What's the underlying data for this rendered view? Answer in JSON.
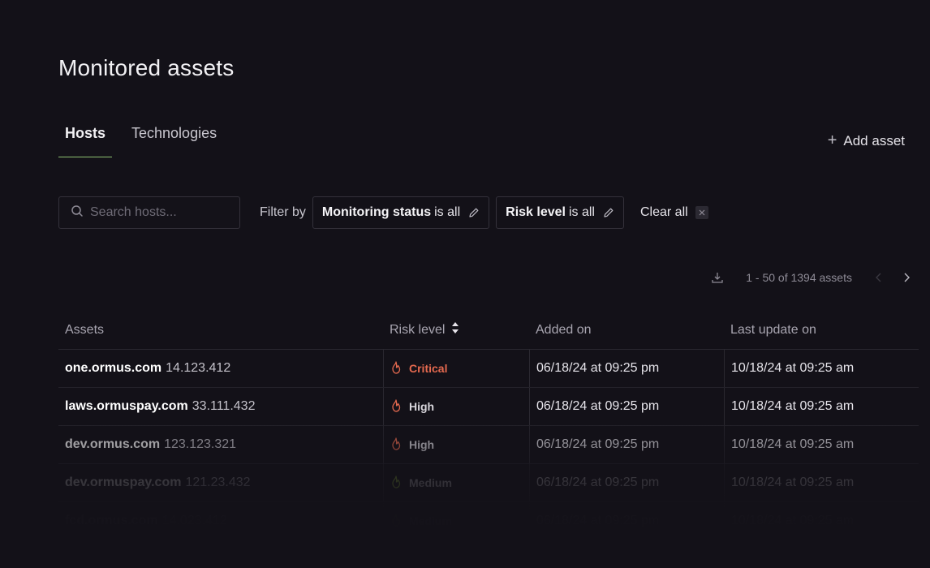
{
  "page": {
    "title": "Monitored assets"
  },
  "tabs": [
    {
      "label": "Hosts",
      "active": true
    },
    {
      "label": "Technologies",
      "active": false
    }
  ],
  "actions": {
    "add_asset": "Add asset"
  },
  "filters": {
    "search_placeholder": "Search hosts...",
    "filter_by": "Filter by",
    "chips": [
      {
        "field": "Monitoring status",
        "value": "is all"
      },
      {
        "field": "Risk level",
        "value": "is all"
      }
    ],
    "clear_all": "Clear all"
  },
  "pagination": {
    "range": "1 - 50 of 1394 assets"
  },
  "table": {
    "columns": [
      "Assets",
      "Risk level",
      "Added on",
      "Last update on"
    ],
    "rows": [
      {
        "host": "one.ormus.com",
        "ip": "14.123.412",
        "risk": "Critical",
        "risk_color": "#e4694f",
        "added": "06/18/24 at 09:25 pm",
        "updated": "10/18/24 at 09:25 am"
      },
      {
        "host": "laws.ormuspay.com",
        "ip": "33.111.432",
        "risk": "High",
        "risk_color": "#e4694f",
        "added": "06/18/24 at 09:25 pm",
        "updated": "10/18/24 at 09:25 am"
      },
      {
        "host": "dev.ormus.com",
        "ip": "123.123.321",
        "risk": "High",
        "risk_color": "#e4694f",
        "added": "06/18/24 at 09:25 pm",
        "updated": "10/18/24 at 09:25 am"
      },
      {
        "host": "dev.ormuspay.com",
        "ip": "121.23.432",
        "risk": "Medium",
        "risk_color": "#a7d63f",
        "added": "06/18/24 at 09:25 pm",
        "updated": "10/18/24 at 09:25 am"
      },
      {
        "host": "fcd.ormus.com",
        "ip": "14.023.412",
        "risk": "Medium",
        "risk_color": "#a7d63f",
        "added": "06/18/24 at 09:25 pm",
        "updated": "10/18/24 at 09:25 am"
      }
    ]
  },
  "colors": {
    "accent": "#8ec070",
    "risk_high": "#e4694f",
    "risk_medium": "#a7d63f"
  }
}
